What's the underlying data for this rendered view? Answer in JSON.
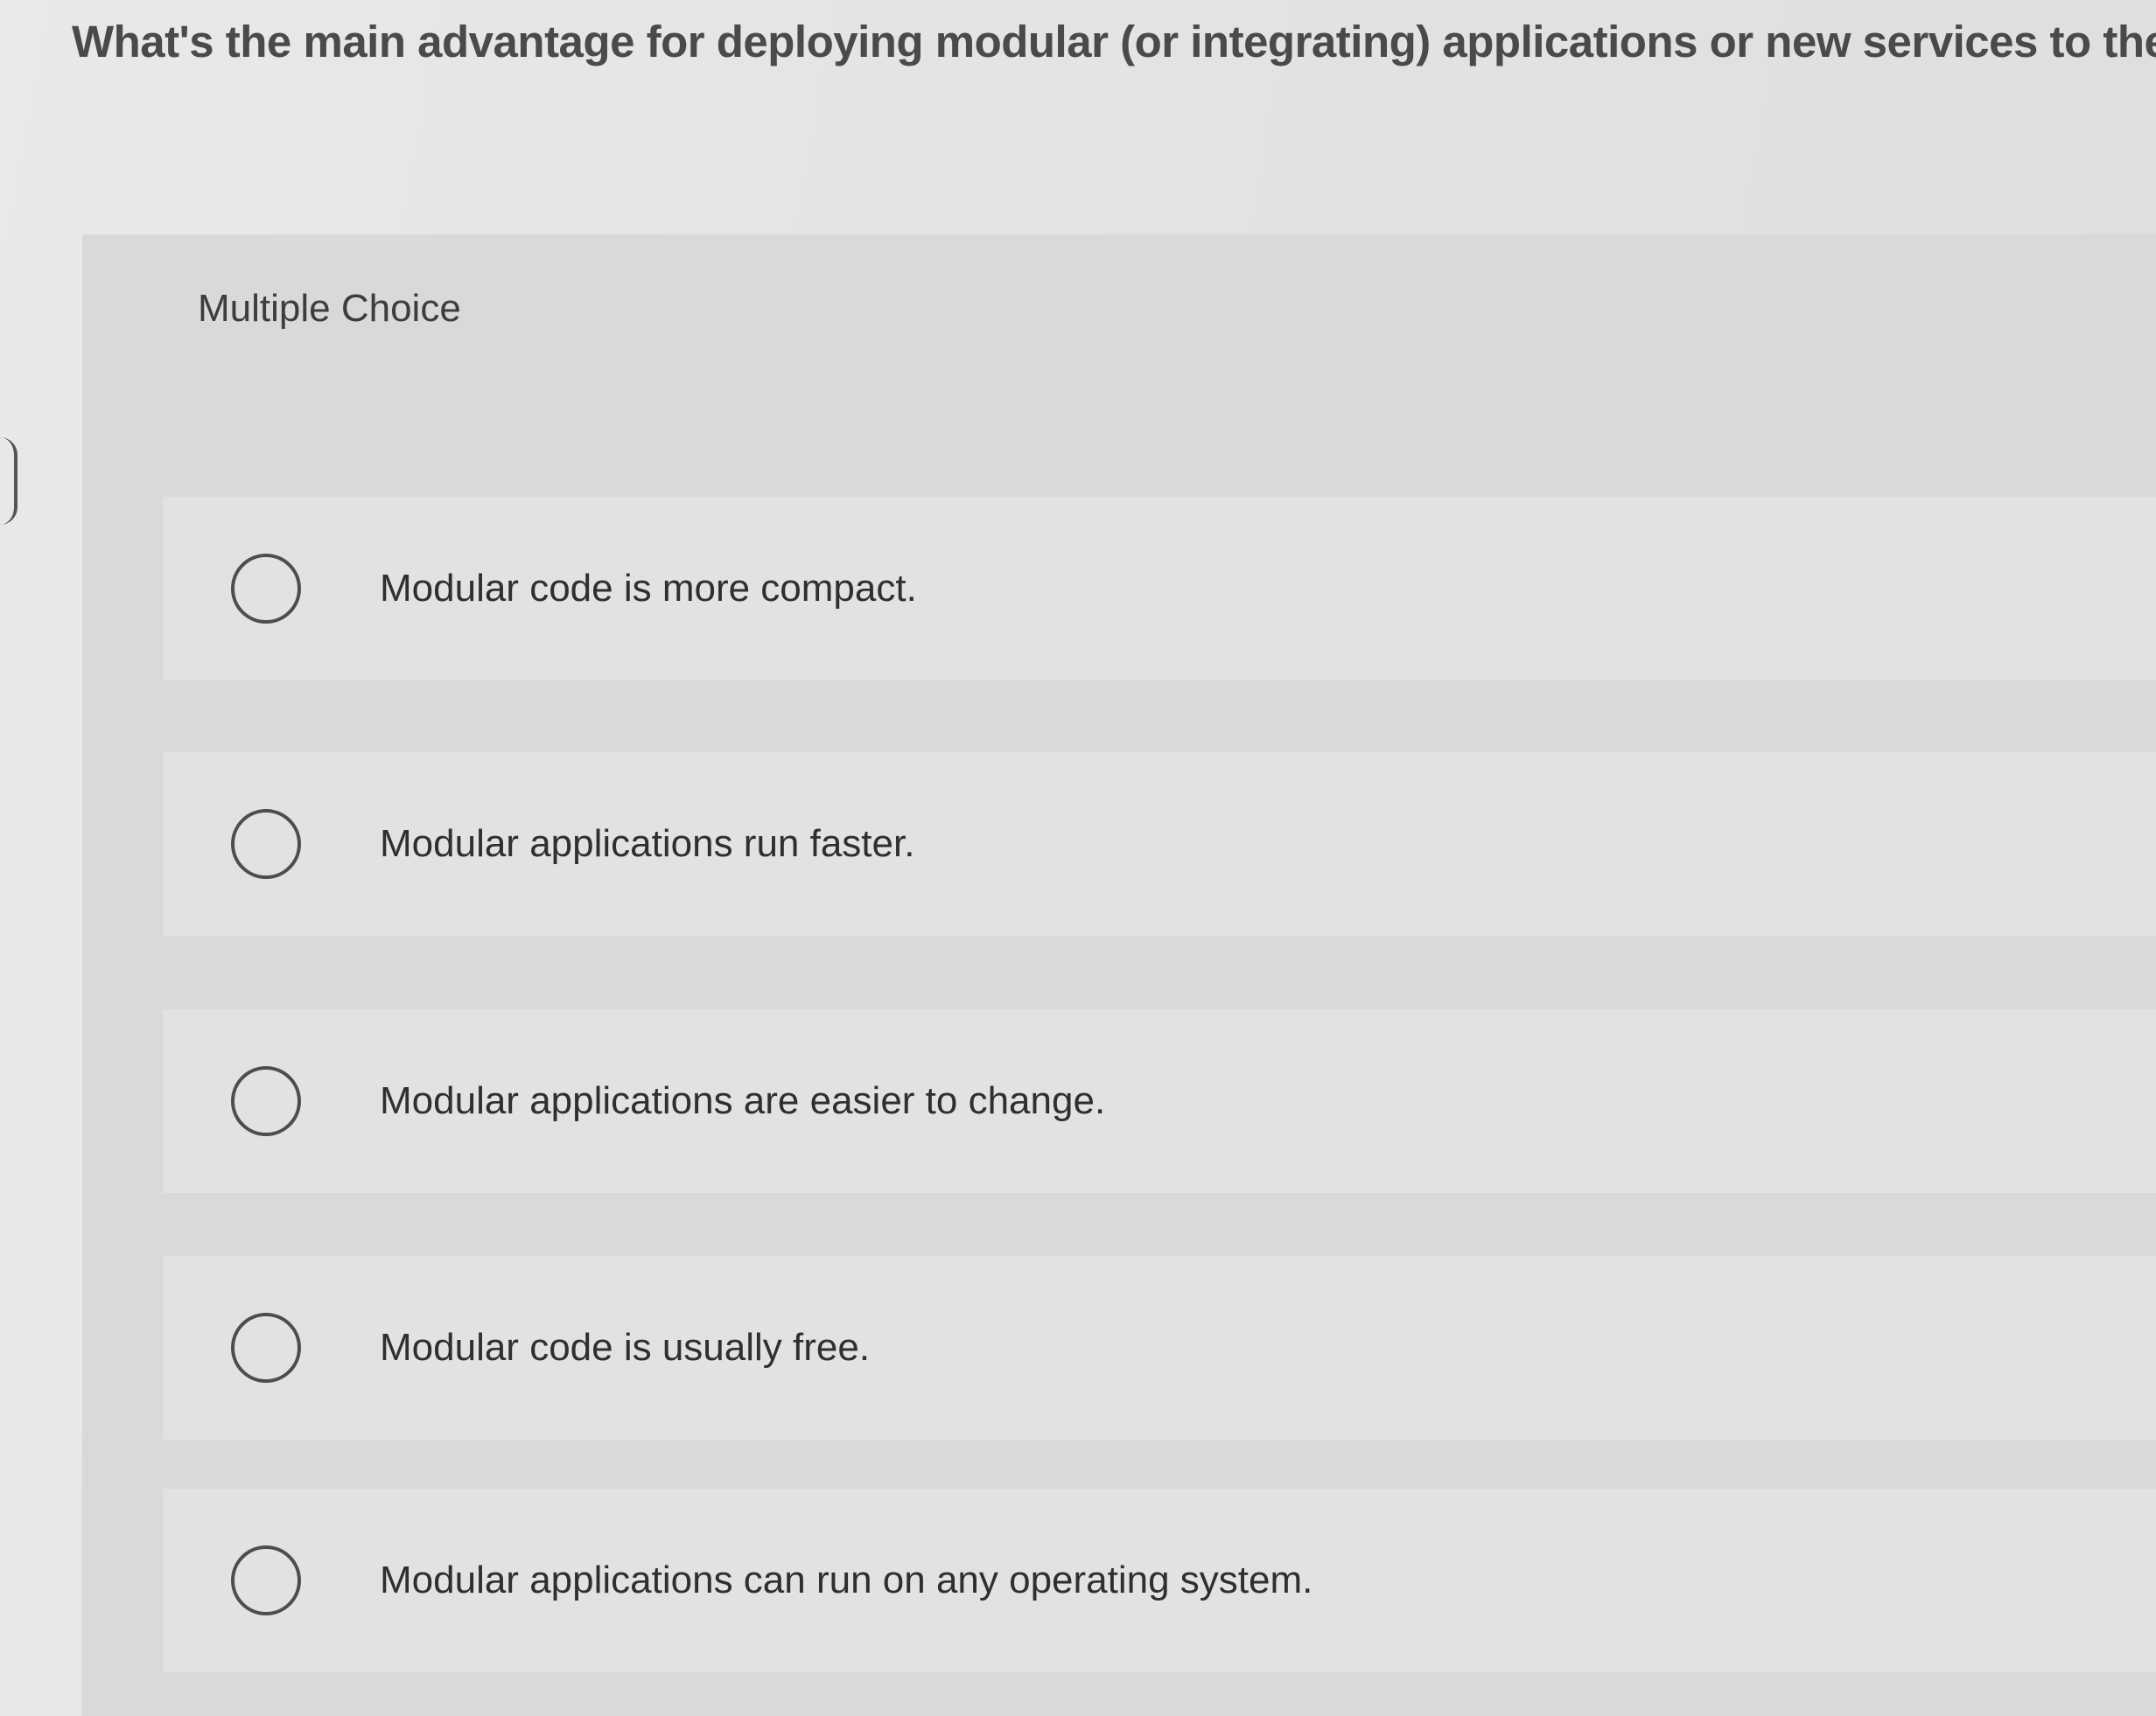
{
  "question": {
    "text": "What's the main advantage for deploying modular (or integrating) applications or new services to the cl"
  },
  "panel": {
    "label": "Multiple Choice"
  },
  "options": [
    {
      "text": "Modular code is more compact."
    },
    {
      "text": "Modular applications run faster."
    },
    {
      "text": "Modular applications are easier to change."
    },
    {
      "text": "Modular code is usually free."
    },
    {
      "text": "Modular applications can run on any operating system."
    }
  ]
}
